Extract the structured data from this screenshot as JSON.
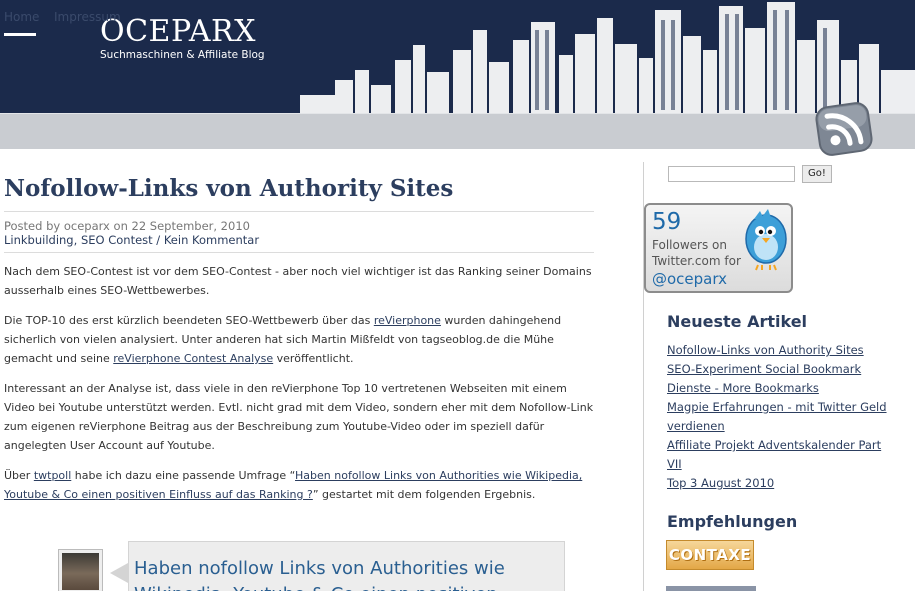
{
  "header": {
    "site_title": "OCEPARX",
    "site_subtitle": "Suchmaschinen & Affiliate Blog"
  },
  "nav": {
    "items": [
      {
        "label": "Home",
        "active": true
      },
      {
        "label": "Impressum",
        "active": false
      }
    ],
    "rss_icon": "rss-icon"
  },
  "post": {
    "title": "Nofollow-Links von Authority Sites",
    "meta": {
      "prefix": "Posted by ",
      "author": "oceparx",
      "on": " on ",
      "date": "22 September, 2010"
    },
    "categories": {
      "cat1": "Linkbuilding",
      "sep1": ", ",
      "cat2": "SEO Contest",
      "sep2": " / ",
      "comments": "Kein Kommentar"
    },
    "p1": "Nach dem SEO-Contest ist vor dem SEO-Contest - aber noch viel wichtiger ist das Ranking seiner Domains ausserhalb eines SEO-Wettbewerbes.",
    "p2": {
      "t1": "Die TOP-10 des erst kürzlich beendeten SEO-Wettbewerb über das ",
      "link1": "reVierphone",
      "t2": " wurden dahingehend sicherlich von vielen analysiert. Unter anderen hat sich Martin Mißfeldt von tagseoblog.de die Mühe gemacht und seine ",
      "link2": "reVierphone Contest Analyse",
      "t3": " veröffentlicht."
    },
    "p3": "Interessant an der Analyse ist, dass viele in den reVierphone Top 10 vertretenen Webseiten mit einem Video bei Youtube unterstützt werden. Evtl. nicht grad mit dem Video, sondern eher mit dem Nofollow-Link zum eigenen reVierphone Beitrag aus der Beschreibung zum Youtube-Video oder im speziell dafür angelegten User Account auf Youtube.",
    "p4": {
      "t1": "Über ",
      "link1": "twtpoll",
      "t2": " habe ich dazu eine passende Umfrage “",
      "link2": "Haben nofollow Links von Authorities wie Wikipedia, Youtube & Co einen positiven Einfluss auf das Ranking ?",
      "t3": "” gestartet mit dem folgenden Ergebnis."
    },
    "poll_question": "Haben nofollow Links von Authorities wie Wikipedia, Youtube & Co einen positiven"
  },
  "sidebar": {
    "search": {
      "value": "",
      "button": "Go!"
    },
    "twitter": {
      "count": "59",
      "line1": "Followers on",
      "line2": "Twitter.com for",
      "handle": "@oceparx"
    },
    "neueste_heading": "Neueste Artikel",
    "recent": [
      "Nofollow-Links von Authority Sites",
      "SEO-Experiment Social Bookmark Dienste - More Bookmarks",
      "",
      "Magpie Erfahrungen - mit Twitter Geld verdienen",
      "Affiliate Projekt Adventskalender Part VII",
      "Top 3 August 2010"
    ],
    "recent_lines": [
      "Nofollow-Links von Authority Sites",
      "SEO-Experiment Social Bookmark",
      "Dienste - More Bookmarks",
      "Magpie Erfahrungen - mit Twitter Geld verdienen",
      "Affiliate Projekt Adventskalender Part VII",
      "Top 3 August 2010"
    ],
    "empf_heading": "Empfehlungen",
    "contaxe": "CONTAXE"
  },
  "colors": {
    "header_bg": "#1b2a4b",
    "nav_bg": "#c9ccd1",
    "link": "#2c3e5f",
    "twitter_blue": "#1f6aa9"
  }
}
